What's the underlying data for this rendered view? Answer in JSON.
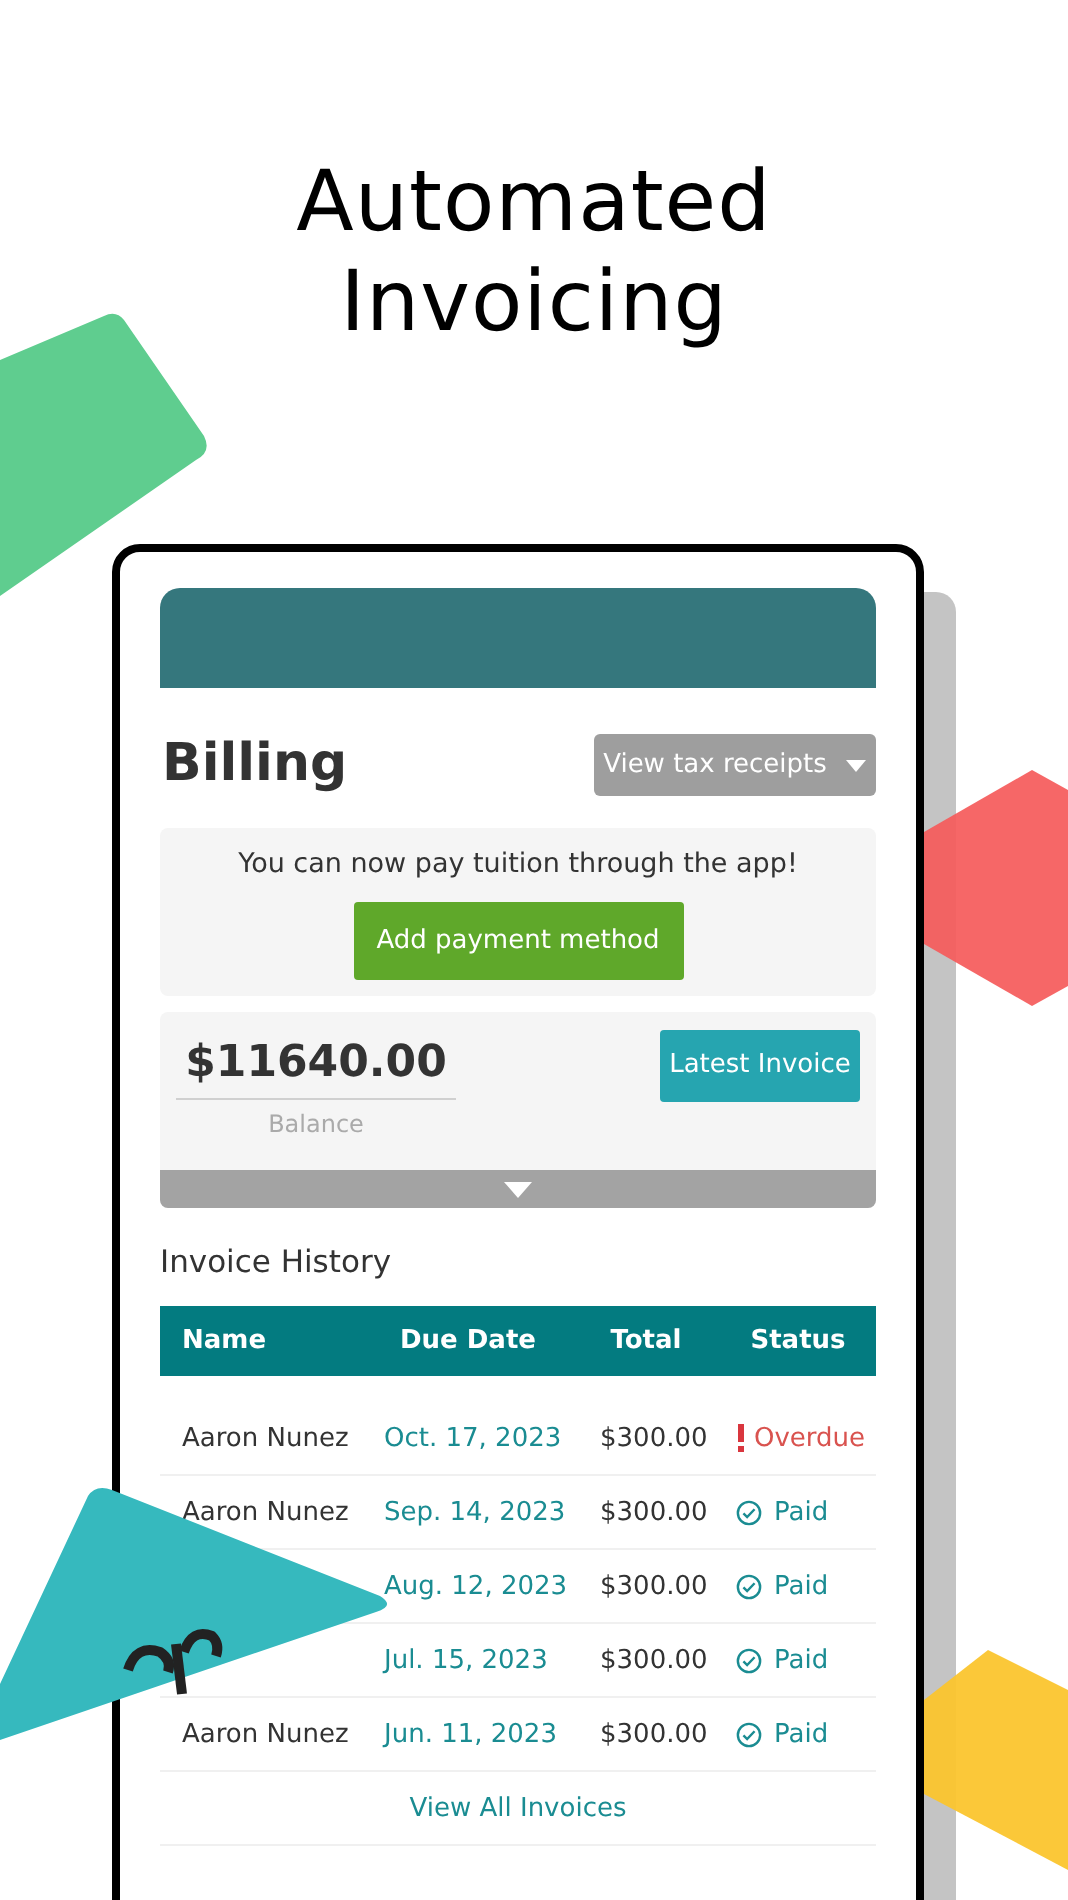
{
  "headline": [
    "Automated",
    "Invoicing"
  ],
  "billing": {
    "title": "Billing",
    "tax_button": "View tax receipts",
    "promo": {
      "message": "You can now pay tuition through the app!",
      "button": "Add payment method"
    },
    "balance": {
      "amount": "$11640.00",
      "label": "Balance",
      "button": "Latest Invoice"
    }
  },
  "invoice_history": {
    "title": "Invoice History",
    "columns": [
      "Name",
      "Due Date",
      "Total",
      "Status"
    ],
    "rows": [
      {
        "name": "Aaron Nunez",
        "due_date": "Oct. 17, 2023",
        "total": "$300.00",
        "status": "Overdue",
        "kind": "overdue"
      },
      {
        "name": "Aaron Nunez",
        "due_date": "Sep. 14, 2023",
        "total": "$300.00",
        "status": "Paid",
        "kind": "paid"
      },
      {
        "due_date": "Aug. 12, 2023",
        "total": "$300.00",
        "status": "Paid",
        "kind": "paid"
      },
      {
        "due_date": "Jul. 15, 2023",
        "total": "$300.00",
        "status": "Paid",
        "kind": "paid"
      },
      {
        "name": "Aaron Nunez",
        "due_date": "Jun. 11, 2023",
        "total": "$300.00",
        "status": "Paid",
        "kind": "paid"
      }
    ],
    "link": "View All Invoices"
  }
}
